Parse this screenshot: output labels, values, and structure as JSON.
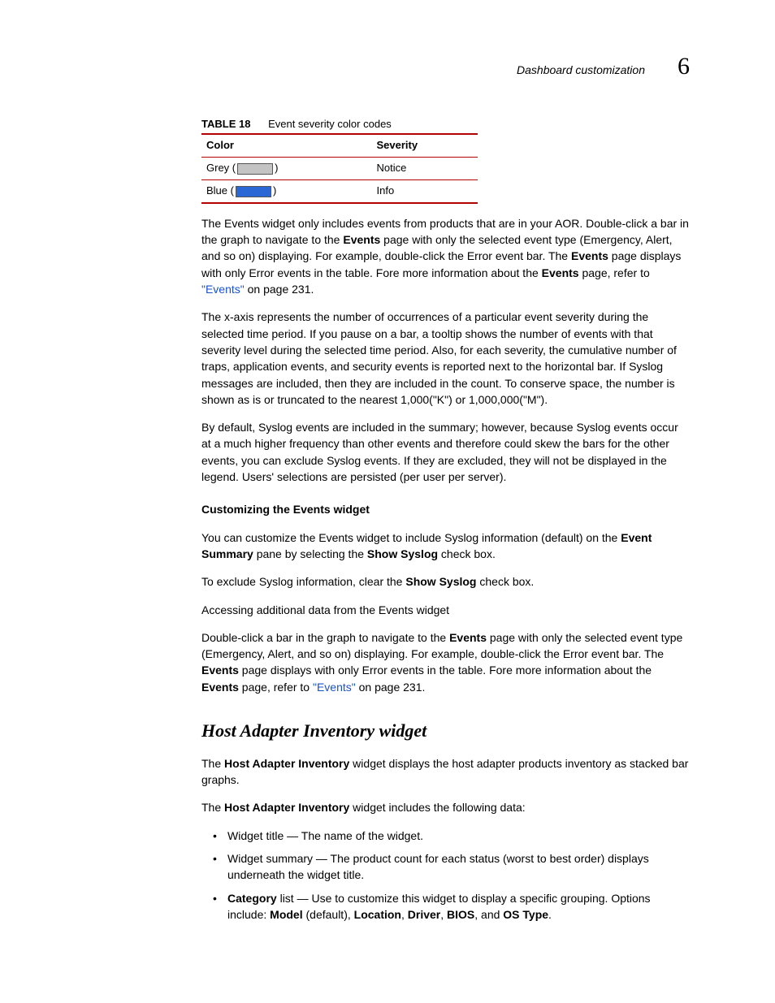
{
  "header": {
    "title": "Dashboard customization",
    "chapter": "6"
  },
  "table": {
    "number": "TABLE 18",
    "title": "Event severity color codes",
    "col1": "Color",
    "col2": "Severity",
    "rows": [
      {
        "color_name": "Grey",
        "severity": "Notice"
      },
      {
        "color_name": "Blue",
        "severity": "Info"
      }
    ]
  },
  "para1": {
    "t1": "The Events widget only includes events from products that are in your AOR. Double-click a bar in the graph to navigate to the ",
    "b1": "Events",
    "t2": " page with only the selected event type (Emergency, Alert, and so on) displaying. For example, double-click the Error event bar. The ",
    "b2": "Events",
    "t3": " page displays with only Error events in the table. Fore more information about the ",
    "b3": "Events",
    "t4": " page, refer to ",
    "link": "\"Events\"",
    "t5": " on page 231."
  },
  "para2": "The x-axis represents the number of occurrences of a particular event severity during the selected time period. If you pause on a bar, a tooltip shows the number of events with that severity level during the selected time period. Also, for each severity, the cumulative number of traps, application events, and security events is reported next to the horizontal bar. If Syslog messages are included, then they are included in the count. To conserve space, the number is shown as is or truncated to the nearest 1,000(\"K\") or 1,000,000(\"M\").",
  "para3": "By default, Syslog events are included in the summary; however, because Syslog events occur at a much higher frequency than other events and therefore could skew the bars for the other events, you can exclude Syslog events.   If they are excluded, they will not be displayed in the legend. Users' selections are persisted (per user per server).",
  "sub1": "Customizing the Events widget",
  "para4": {
    "t1": "You can customize the Events widget to include Syslog information (default) on the ",
    "b1": "Event Summary",
    "t2": " pane by selecting the ",
    "b2": "Show Syslog",
    "t3": " check box."
  },
  "para5": {
    "t1": "To exclude Syslog information, clear the ",
    "b1": "Show Syslog",
    "t2": " check box."
  },
  "para6": "Accessing additional data from the Events widget",
  "para7": {
    "t1": "Double-click a bar in the graph to navigate to the ",
    "b1": "Events",
    "t2": " page with only the selected event type (Emergency, Alert, and so on) displaying. For example, double-click the Error event bar. The ",
    "b2": "Events",
    "t3": " page displays with only Error events in the table. Fore more information about the ",
    "b3": "Events",
    "t4": " page, refer to ",
    "link": "\"Events\"",
    "t5": " on page 231."
  },
  "h2": "Host Adapter Inventory widget",
  "para8": {
    "t1": "The ",
    "b1": "Host Adapter Inventory",
    "t2": " widget displays the host adapter products inventory as stacked bar graphs."
  },
  "para9": {
    "t1": "The ",
    "b1": "Host Adapter Inventory",
    "t2": " widget includes the following data:"
  },
  "bullets": {
    "li1": "Widget title — The name of the widget.",
    "li2": "Widget summary — The product count for each status (worst to best order) displays underneath the widget title.",
    "li3": {
      "b1": "Category",
      "t1": " list — Use to customize this widget to display a specific grouping. Options include: ",
      "b2": "Model",
      "t2": " (default), ",
      "b3": "Location",
      "t3": ", ",
      "b4": "Driver",
      "t4": ", ",
      "b5": "BIOS",
      "t5": ", and ",
      "b6": "OS Type",
      "t6": "."
    }
  }
}
